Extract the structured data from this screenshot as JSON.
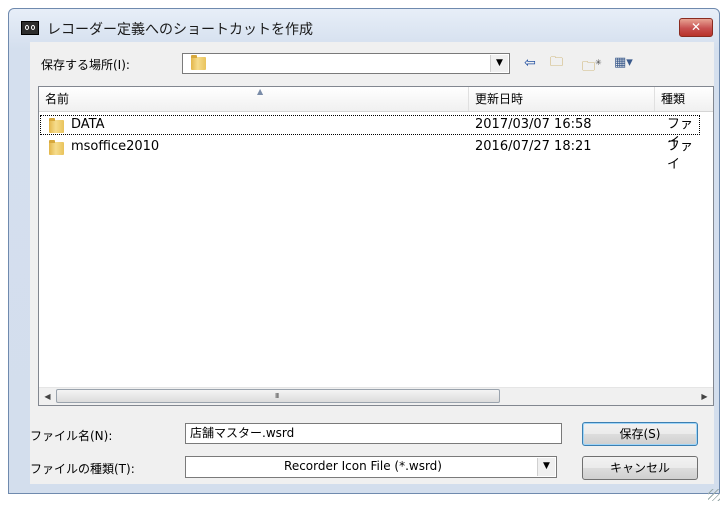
{
  "window": {
    "title": "レコーダー定義へのショートカットを作成",
    "close_label": "✕"
  },
  "location": {
    "label": "保存する場所(I):",
    "value": ""
  },
  "toolbar": {
    "back_icon": "back-arrow-icon",
    "up_icon": "up-folder-icon",
    "new_folder_icon": "new-folder-icon",
    "view_menu_icon": "view-menu-icon"
  },
  "list": {
    "columns": [
      "名前",
      "更新日時",
      "種類"
    ],
    "rows": [
      {
        "name": "DATA",
        "date": "2017/03/07 16:58",
        "type": "ファイ"
      },
      {
        "name": "msoffice2010",
        "date": "2016/07/27 18:21",
        "type": "ファイ"
      }
    ]
  },
  "filename": {
    "label": "ファイル名(N):",
    "value": "店舗マスター.wsrd"
  },
  "filetype": {
    "label": "ファイルの種類(T):",
    "value": "Recorder Icon File (*.wsrd)"
  },
  "buttons": {
    "save": "保存(S)",
    "cancel": "キャンセル"
  }
}
